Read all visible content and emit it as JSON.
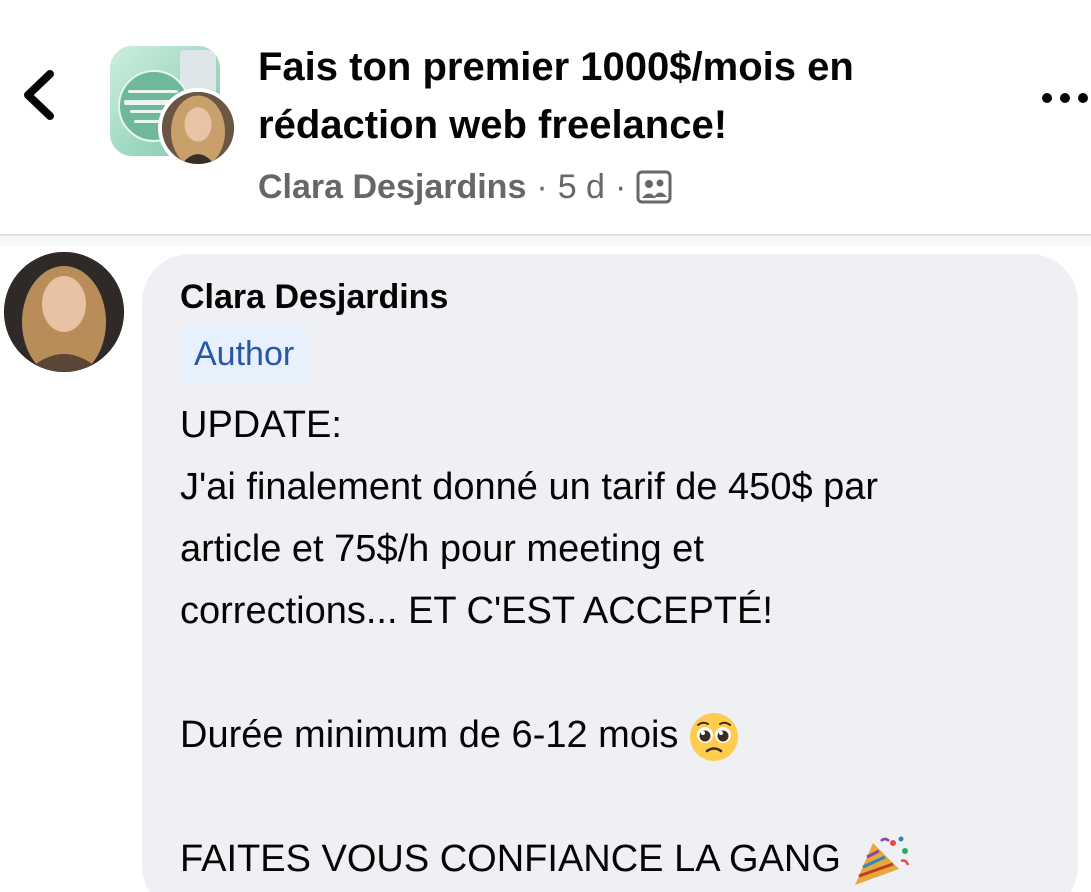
{
  "header": {
    "group_title_line1": "Fais ton premier 1000$/mois en",
    "group_title_line2": "rédaction web freelance!",
    "author": "Clara Desjardins",
    "separator": "·",
    "time_ago": "5 d",
    "audience_icon": "group-audience-icon",
    "back_icon": "chevron-left-icon",
    "more_icon": "more-horizontal-icon"
  },
  "comment": {
    "author": "Clara Desjardins",
    "badge": "Author",
    "lines": [
      "UPDATE:",
      "J'ai finalement donné un tarif de 450$ par",
      "article et 75$/h pour meeting et",
      "corrections... ET C'EST ACCEPTÉ!",
      "",
      "Durée minimum de 6-12 mois",
      "",
      "FAITES VOUS CONFIANCE LA GANG"
    ],
    "emoji_line6": "pleading-face-emoji",
    "emoji_line8": "party-popper-emoji"
  },
  "colors": {
    "secondary_text": "#65676b",
    "bubble_bg": "#eff0f4",
    "badge_bg": "#e7f0fd",
    "badge_text": "#2857a6"
  }
}
